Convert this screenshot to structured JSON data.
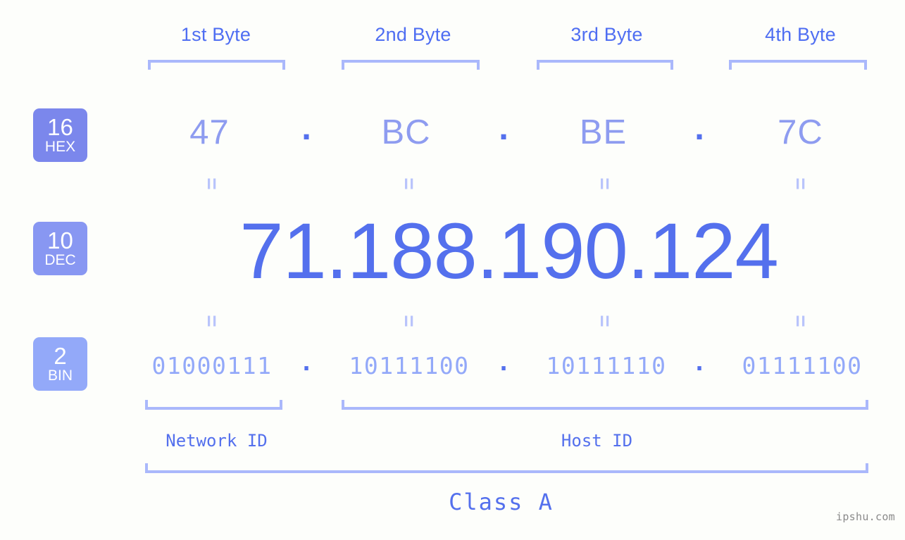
{
  "background_color": "#fdfefb",
  "accent_colors": {
    "badge_hex": "#7b87ec",
    "badge_dec": "#8897f2",
    "badge_bin": "#93a9f9",
    "header_text": "#4f6ef2",
    "bracket": "#aab8fb",
    "hex_text": "#8e9cf0",
    "dec_text": "#5470ed",
    "bin_text": "#93a9f9",
    "dot": "#5470ed",
    "equals": "#b9c4fb",
    "watermark": "#8a8a8a"
  },
  "byte_headers": [
    {
      "label": "1st Byte"
    },
    {
      "label": "2nd Byte"
    },
    {
      "label": "3rd Byte"
    },
    {
      "label": "4th Byte"
    }
  ],
  "rows": {
    "hex": {
      "badge_number": "16",
      "badge_name": "HEX",
      "octets": [
        "47",
        "BC",
        "BE",
        "7C"
      ],
      "separator": "."
    },
    "dec": {
      "badge_number": "10",
      "badge_name": "DEC",
      "octets": [
        "71",
        "188",
        "190",
        "124"
      ],
      "separator": ".",
      "full_address": "71.188.190.124"
    },
    "bin": {
      "badge_number": "2",
      "badge_name": "BIN",
      "octets": [
        "01000111",
        "10111100",
        "10111110",
        "01111100"
      ],
      "separator": ".",
      "full_address": "01000111.10111100.10111110.01111100"
    }
  },
  "equals_symbol": "=",
  "id_sections": [
    {
      "label": "Network ID"
    },
    {
      "label": "Host ID"
    }
  ],
  "class_label": "Class A",
  "watermark": "ipshu.com"
}
